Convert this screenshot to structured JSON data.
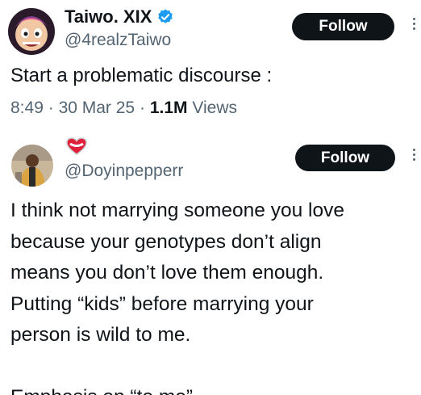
{
  "tweet1": {
    "display_name": "Taiwo. XIX",
    "handle": "@4realzTaiwo",
    "follow_label": "Follow",
    "text": "Start a problematic discourse :",
    "time": "8:49",
    "date": "30 Mar 25",
    "views_count": "1.1M",
    "views_label": "Views",
    "separator": "·",
    "verified_icon": "verified-badge-icon",
    "accent_color": "#1d9bf0"
  },
  "tweet2": {
    "display_name_emoji": "❤️",
    "handle": "@Doyinpepperr",
    "follow_label": "Follow",
    "lines": [
      "I think not marrying someone you love",
      "because your genotypes don’t align",
      "means you don’t love them enough.",
      "Putting “kids” before marrying your",
      "person is wild to me."
    ],
    "emphasis_line": "Emphasis on “to me”"
  }
}
